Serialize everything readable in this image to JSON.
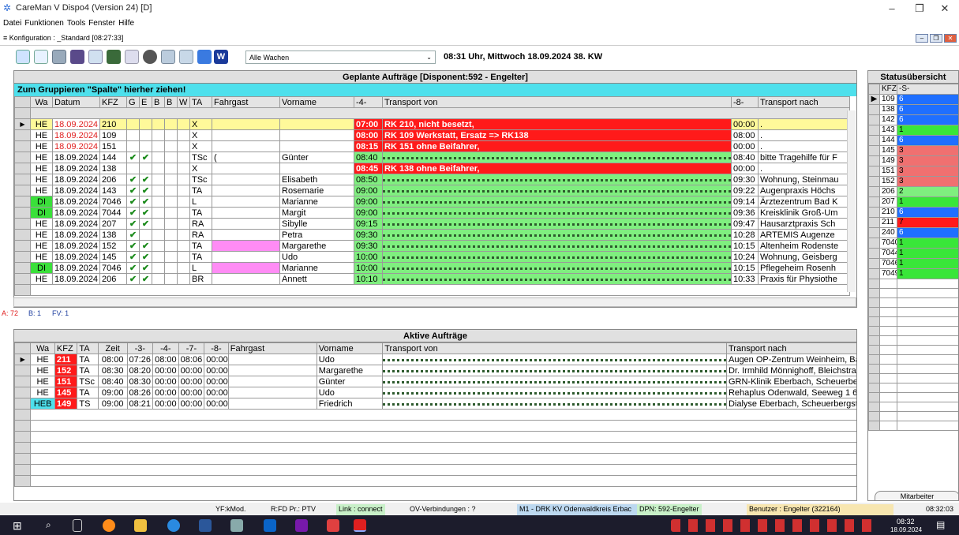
{
  "window": {
    "title": "CareMan V Dispo4 (Version 24) [D]"
  },
  "menu": [
    "Datei",
    "Funktionen",
    "Tools",
    "Fenster",
    "Hilfe"
  ],
  "config": {
    "label": "Konfiguration : _Standard [08:27:33]"
  },
  "toolbar": {
    "wachen": "Alle Wachen",
    "clock": "08:31 Uhr, Mittwoch 18.09.2024 38. KW"
  },
  "planned": {
    "title": "Geplante Aufträge  [Disponent:592  - Engelter]",
    "group_hint": "Zum Gruppieren \"Spalte\" hierher ziehen!",
    "headers": [
      "Wa",
      "Datum",
      "KFZ",
      "G",
      "E",
      "B",
      "B",
      "W",
      "TA",
      "Fahrgast",
      "Vorname",
      "-4-",
      "Transport von",
      "-8-",
      "Transport nach"
    ],
    "rows": [
      {
        "wa": "HE",
        "datum": "18.09.2024",
        "kfz": "210",
        "g": "",
        "e": "",
        "ta": "X",
        "fahrgast": "",
        "vorname": "",
        "t4": "07:00",
        "von": "RK 210, nicht besetzt,",
        "t8": "00:00",
        "nach": ".",
        "style": "yellow",
        "vonstyle": "red",
        "wastyle": "",
        "datumstyle": "redtxt"
      },
      {
        "wa": "HE",
        "datum": "18.09.2024",
        "kfz": "109",
        "g": "",
        "e": "",
        "ta": "X",
        "fahrgast": "",
        "vorname": "",
        "t4": "08:00",
        "von": "RK 109 Werkstatt, Ersatz => RK138",
        "t8": "08:00",
        "nach": ".",
        "style": "",
        "vonstyle": "red",
        "wastyle": "",
        "datumstyle": "redtxt"
      },
      {
        "wa": "HE",
        "datum": "18.09.2024",
        "kfz": "151",
        "g": "",
        "e": "",
        "ta": "X",
        "fahrgast": "",
        "vorname": "",
        "t4": "08:15",
        "von": "RK 151 ohne Beifahrer,",
        "t8": "00:00",
        "nach": ".",
        "style": "",
        "vonstyle": "red",
        "wastyle": "",
        "datumstyle": "redtxt"
      },
      {
        "wa": "HE",
        "datum": "18.09.2024",
        "kfz": "144",
        "g": "✔",
        "e": "✔",
        "ta": "TSc",
        "fahrgast": "(",
        "vorname": "Günter",
        "t4": "08:40",
        "von": "",
        "t8": "08:40",
        "nach": "bitte Tragehilfe für F",
        "style": "",
        "vonstyle": "green",
        "wastyle": "",
        "datumstyle": ""
      },
      {
        "wa": "HE",
        "datum": "18.09.2024",
        "kfz": "138",
        "g": "",
        "e": "",
        "ta": "X",
        "fahrgast": "",
        "vorname": "",
        "t4": "08:45",
        "von": "RK 138 ohne Beifahrer,",
        "t8": "00:00",
        "nach": ".",
        "style": "",
        "vonstyle": "red",
        "wastyle": "",
        "datumstyle": ""
      },
      {
        "wa": "HE",
        "datum": "18.09.2024",
        "kfz": "206",
        "g": "✔",
        "e": "✔",
        "ta": "TSc",
        "fahrgast": "",
        "vorname": "Elisabeth",
        "t4": "08:50",
        "von": "",
        "t8": "09:30",
        "nach": "Wohnung, Steinmau",
        "style": "",
        "vonstyle": "green",
        "wastyle": "",
        "datumstyle": ""
      },
      {
        "wa": "HE",
        "datum": "18.09.2024",
        "kfz": "143",
        "g": "✔",
        "e": "✔",
        "ta": "TA",
        "fahrgast": "",
        "vorname": "Rosemarie",
        "t4": "09:00",
        "von": "",
        "t8": "09:22",
        "nach": "Augenpraxis Höchs",
        "style": "",
        "vonstyle": "green",
        "wastyle": "",
        "datumstyle": ""
      },
      {
        "wa": "DI",
        "datum": "18.09.2024",
        "kfz": "7046",
        "g": "✔",
        "e": "✔",
        "ta": "L",
        "fahrgast": "",
        "vorname": "Marianne",
        "t4": "09:00",
        "von": "",
        "t8": "09:14",
        "nach": "Ärztezentrum Bad K",
        "style": "",
        "vonstyle": "green",
        "wastyle": "lime",
        "datumstyle": ""
      },
      {
        "wa": "DI",
        "datum": "18.09.2024",
        "kfz": "7044",
        "g": "✔",
        "e": "✔",
        "ta": "TA",
        "fahrgast": "",
        "vorname": "Margit",
        "t4": "09:00",
        "von": "",
        "t8": "09:36",
        "nach": "Kreisklinik Groß-Um",
        "style": "",
        "vonstyle": "green",
        "wastyle": "lime",
        "datumstyle": ""
      },
      {
        "wa": "HE",
        "datum": "18.09.2024",
        "kfz": "207",
        "g": "✔",
        "e": "✔",
        "ta": "RA",
        "fahrgast": "",
        "vorname": "Sibylle",
        "t4": "09:15",
        "von": "",
        "t8": "09:47",
        "nach": "Hausarztpraxis Sch",
        "style": "",
        "vonstyle": "green",
        "wastyle": "",
        "datumstyle": ""
      },
      {
        "wa": "HE",
        "datum": "18.09.2024",
        "kfz": "138",
        "g": "✔",
        "e": "",
        "ta": "RA",
        "fahrgast": "",
        "vorname": "Petra",
        "t4": "09:30",
        "von": "",
        "t8": "10:28",
        "nach": "ARTEMIS Augenze",
        "style": "",
        "vonstyle": "green",
        "wastyle": "",
        "datumstyle": ""
      },
      {
        "wa": "HE",
        "datum": "18.09.2024",
        "kfz": "152",
        "g": "✔",
        "e": "✔",
        "ta": "TA",
        "fahrgast": "",
        "vorname": "Margarethe",
        "t4": "09:30",
        "von": "",
        "t8": "10:15",
        "nach": "Altenheim Rodenste",
        "style": "",
        "vonstyle": "green",
        "wastyle": "",
        "datumstyle": "",
        "fgstyle": "pink"
      },
      {
        "wa": "HE",
        "datum": "18.09.2024",
        "kfz": "145",
        "g": "✔",
        "e": "✔",
        "ta": "TA",
        "fahrgast": "",
        "vorname": "Udo",
        "t4": "10:00",
        "von": "",
        "t8": "10:24",
        "nach": "Wohnung, Geisberg",
        "style": "",
        "vonstyle": "green",
        "wastyle": "",
        "datumstyle": ""
      },
      {
        "wa": "DI",
        "datum": "18.09.2024",
        "kfz": "7046",
        "g": "✔",
        "e": "✔",
        "ta": "L",
        "fahrgast": "",
        "vorname": "Marianne",
        "t4": "10:00",
        "von": "",
        "t8": "10:15",
        "nach": "Pflegeheim Rosenh",
        "style": "",
        "vonstyle": "green",
        "wastyle": "lime",
        "datumstyle": "",
        "fgstyle": "pink"
      },
      {
        "wa": "HE",
        "datum": "18.09.2024",
        "kfz": "206",
        "g": "✔",
        "e": "✔",
        "ta": "BR",
        "fahrgast": "",
        "vorname": "Annett",
        "t4": "10:10",
        "von": "",
        "t8": "10:33",
        "nach": "Praxis für Physiothe",
        "style": "",
        "vonstyle": "green",
        "wastyle": "",
        "datumstyle": ""
      }
    ]
  },
  "counts": {
    "a": "A: 72",
    "b": "B: 1",
    "fv": "FV: 1"
  },
  "active": {
    "title": "Aktive Aufträge",
    "headers": [
      "Wa",
      "KFZ",
      "TA",
      "Zeit",
      "-3-",
      "-4-",
      "-7-",
      "-8-",
      "Fahrgast",
      "Vorname",
      "Transport von",
      "Transport nach"
    ],
    "rows": [
      {
        "wa": "HE",
        "kfz": "211",
        "ta": "TA",
        "zeit": "08:00",
        "t3": "07:26",
        "t4": "08:00",
        "t7": "08:06",
        "t8": "00:00",
        "fahrgast": "",
        "vorname": "Udo",
        "nach": "Augen OP-Zentrum Weinheim, Bah",
        "kfzstyle": "red",
        "wastyle": ""
      },
      {
        "wa": "HE",
        "kfz": "152",
        "ta": "TA",
        "zeit": "08:30",
        "t3": "08:20",
        "t4": "00:00",
        "t7": "00:00",
        "t8": "00:00",
        "fahrgast": "",
        "vorname": "Margarethe",
        "nach": "Dr. Irmhild Mönnighoff, Bleichstraße",
        "kfzstyle": "red",
        "wastyle": ""
      },
      {
        "wa": "HE",
        "kfz": "151",
        "ta": "TSc",
        "zeit": "08:40",
        "t3": "08:30",
        "t4": "00:00",
        "t7": "00:00",
        "t8": "00:00",
        "fahrgast": "",
        "vorname": "Günter",
        "nach": "GRN-Klinik Eberbach, Scheuerber",
        "kfzstyle": "red",
        "wastyle": ""
      },
      {
        "wa": "HE",
        "kfz": "145",
        "ta": "TA",
        "zeit": "09:00",
        "t3": "08:26",
        "t4": "00:00",
        "t7": "00:00",
        "t8": "00:00",
        "fahrgast": "",
        "vorname": "Udo",
        "nach": "Rehaplus Odenwald, Seeweg 1 64",
        "kfzstyle": "red",
        "wastyle": ""
      },
      {
        "wa": "HEB",
        "kfz": "149",
        "ta": "TS",
        "zeit": "09:00",
        "t3": "08:21",
        "t4": "00:00",
        "t7": "00:00",
        "t8": "00:00",
        "fahrgast": "",
        "vorname": "Friedrich",
        "nach": "Dialyse Eberbach, Scheuerbergst",
        "kfzstyle": "red",
        "wastyle": "cyan"
      }
    ]
  },
  "status": {
    "title": "Statusübersicht",
    "headers": [
      "KFZ",
      "-S-"
    ],
    "rows": [
      {
        "kfz": "109",
        "s": "6",
        "color": "#1f6fff"
      },
      {
        "kfz": "138",
        "s": "6",
        "color": "#1f6fff"
      },
      {
        "kfz": "142",
        "s": "6",
        "color": "#1f6fff"
      },
      {
        "kfz": "143",
        "s": "1",
        "color": "#39e639"
      },
      {
        "kfz": "144",
        "s": "6",
        "color": "#1f6fff"
      },
      {
        "kfz": "145",
        "s": "3",
        "color": "#f07070"
      },
      {
        "kfz": "149",
        "s": "3",
        "color": "#f07070"
      },
      {
        "kfz": "151",
        "s": "3",
        "color": "#f07070"
      },
      {
        "kfz": "152",
        "s": "3",
        "color": "#f07070"
      },
      {
        "kfz": "206",
        "s": "2",
        "color": "#7fef7f"
      },
      {
        "kfz": "207",
        "s": "1",
        "color": "#39e639"
      },
      {
        "kfz": "210",
        "s": "6",
        "color": "#1f6fff"
      },
      {
        "kfz": "211",
        "s": "7",
        "color": "#ff1a1a"
      },
      {
        "kfz": "240",
        "s": "6",
        "color": "#1f6fff"
      },
      {
        "kfz": "7040",
        "s": "1",
        "color": "#39e639"
      },
      {
        "kfz": "7044",
        "s": "1",
        "color": "#39e639"
      },
      {
        "kfz": "7046",
        "s": "1",
        "color": "#39e639"
      },
      {
        "kfz": "7049",
        "s": "1",
        "color": "#39e639"
      }
    ],
    "tab": "Mitarbeiter"
  },
  "statusbar": {
    "yf": "YF:kMod.",
    "rfd": "R:FD  Pr.: PTV",
    "link": "Link : connect",
    "ov": "OV-Verbindungen : ?",
    "m1": "M1 - DRK KV Odenwaldkreis Erbac",
    "dpn": "DPN: 592-Engelter",
    "user": "Benutzer : Engelter (322164)",
    "time": "08:32:03"
  },
  "taskbar": {
    "time": "08:32",
    "date": "18.09.2024"
  }
}
